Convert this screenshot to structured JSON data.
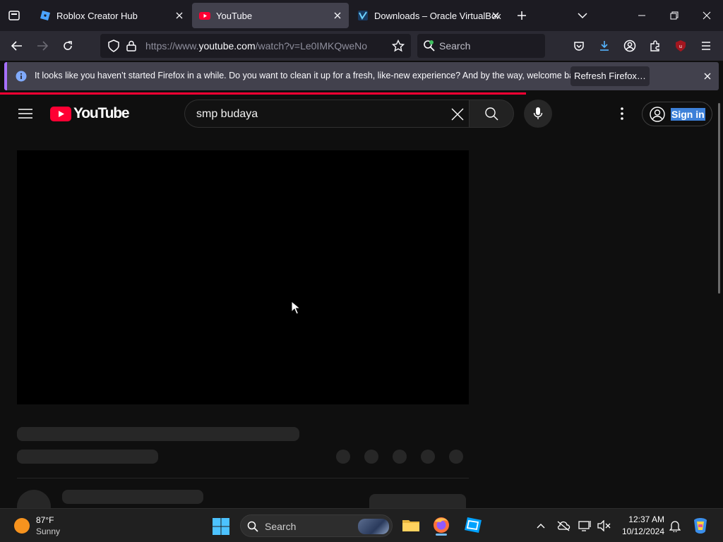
{
  "browser": {
    "tabs": [
      {
        "title": "Roblox Creator Hub",
        "favicon": "roblox-icon",
        "active": false
      },
      {
        "title": "YouTube",
        "favicon": "youtube-icon",
        "active": true
      },
      {
        "title": "Downloads – Oracle VirtualBox",
        "favicon": "virtualbox-icon",
        "active": false
      }
    ],
    "url_prefix": "https://www.",
    "url_host": "youtube.com",
    "url_path": "/watch?v=Le0IMKQweNo",
    "search_placeholder": "Search",
    "extension_badge": "29"
  },
  "notification": {
    "message": "It looks like you haven’t started Firefox in a while. Do you want to clean it up for a fresh, like-new experience? And by the way, welcome back!",
    "button_label": "Refresh Firefox…"
  },
  "youtube": {
    "logo_text": "YouTube",
    "search_value": "smp budaya",
    "signin_label": "Sign in"
  },
  "taskbar": {
    "weather_temp": "87°F",
    "weather_desc": "Sunny",
    "search_label": "Search",
    "time": "12:37 AM",
    "date": "10/12/2024"
  },
  "colors": {
    "youtube_red": "#ff0033",
    "firefox_accent": "#a770ff",
    "selection_blue": "#3d80d8"
  }
}
